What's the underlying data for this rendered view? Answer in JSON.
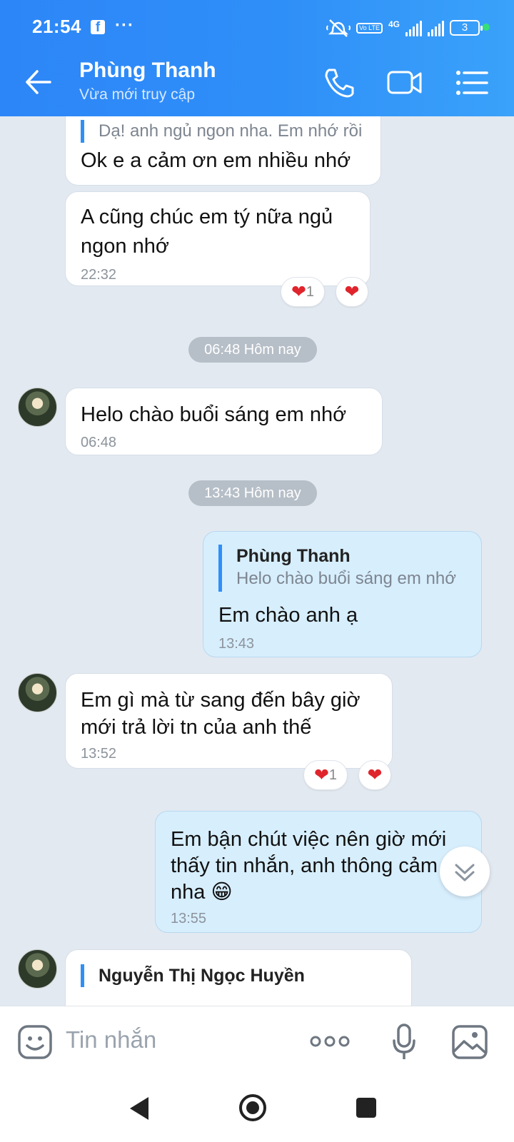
{
  "status": {
    "time": "21:54",
    "network": "4G",
    "volte": "Vo LTE",
    "battery": "3"
  },
  "header": {
    "contact_name": "Phùng Thanh",
    "presence": "Vừa mới truy cập"
  },
  "messages": [
    {
      "quote_text": "Dạ! anh ngủ ngon nha. Em nhớ rồi",
      "text": "Ok e a cảm ơn em nhiều nhớ"
    },
    {
      "line1": "A cũng chúc em tý nữa ngủ",
      "line2": "ngon nhớ",
      "time": "22:32",
      "reaction_count": "1"
    },
    {
      "date": "06:48 Hôm nay"
    },
    {
      "text": "Helo chào buổi sáng em nhớ",
      "time": "06:48"
    },
    {
      "date": "13:43 Hôm nay"
    },
    {
      "quote_name": "Phùng Thanh",
      "quote_text": "Helo chào buổi sáng em nhớ",
      "text": "Em chào anh ạ",
      "time": "13:43"
    },
    {
      "line1": "Em gì mà từ sang đến bây giờ",
      "line2": "mới trả lời tn của anh thế",
      "time": "13:52",
      "reaction_count": "1"
    },
    {
      "line1": "Em bận chút việc nên giờ mới",
      "line2": "thấy tin nhắn, anh thông cảm",
      "line3": "nha",
      "emoji": "😁",
      "time": "13:55"
    },
    {
      "quote_name": "Nguyễn Thị Ngọc Huyền"
    }
  ],
  "composer": {
    "placeholder": "Tin nhắn"
  }
}
